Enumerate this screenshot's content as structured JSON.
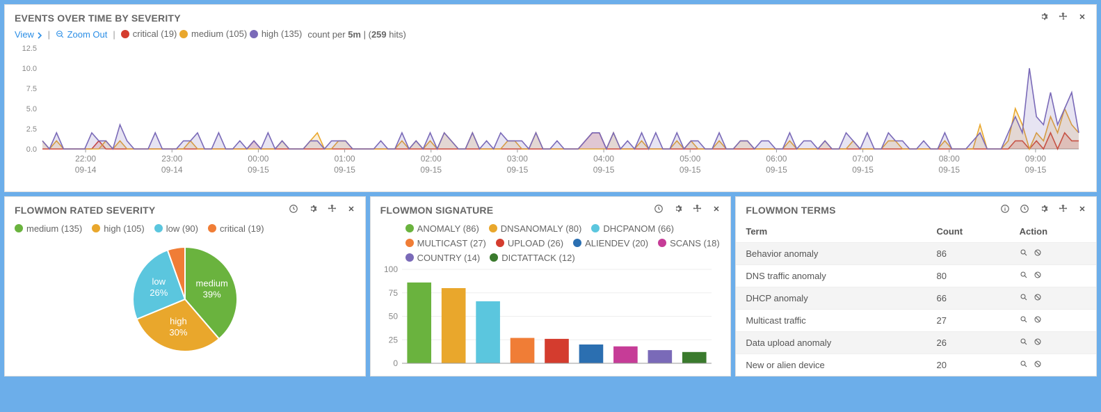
{
  "events_panel": {
    "title": "EVENTS OVER TIME BY SEVERITY",
    "view_label": "View",
    "zoom_label": "Zoom Out",
    "count_prefix": "count per",
    "count_interval": "5m",
    "hits": "259",
    "hits_suffix": "hits",
    "legend": [
      {
        "label": "critical (19)",
        "color": "#d43c2e"
      },
      {
        "label": "medium (105)",
        "color": "#e9a72c"
      },
      {
        "label": "high (135)",
        "color": "#7a6ab8"
      }
    ]
  },
  "chart_data": [
    {
      "panel": "events_over_time",
      "type": "area",
      "ylim": [
        0,
        12.5
      ],
      "y_ticks": [
        0.0,
        2.5,
        5.0,
        7.5,
        10.0,
        12.5
      ],
      "x_major": [
        {
          "top": "22:00",
          "bottom": "09-14"
        },
        {
          "top": "23:00",
          "bottom": "09-14"
        },
        {
          "top": "00:00",
          "bottom": "09-15"
        },
        {
          "top": "01:00",
          "bottom": "09-15"
        },
        {
          "top": "02:00",
          "bottom": "09-15"
        },
        {
          "top": "03:00",
          "bottom": "09-15"
        },
        {
          "top": "04:00",
          "bottom": "09-15"
        },
        {
          "top": "05:00",
          "bottom": "09-15"
        },
        {
          "top": "06:00",
          "bottom": "09-15"
        },
        {
          "top": "07:00",
          "bottom": "09-15"
        },
        {
          "top": "08:00",
          "bottom": "09-15"
        },
        {
          "top": "09:00",
          "bottom": "09-15"
        }
      ],
      "series": [
        {
          "name": "critical",
          "color": "#d43c2e",
          "values": [
            0,
            0,
            0,
            0,
            0,
            0,
            0,
            0,
            1,
            0,
            0,
            0,
            0,
            0,
            0,
            0,
            0,
            0,
            0,
            0,
            0,
            0,
            0,
            0,
            0,
            0,
            0,
            0,
            0,
            0,
            1,
            0,
            0,
            0,
            0,
            0,
            0,
            0,
            0,
            0,
            0,
            0,
            0,
            0,
            0,
            0,
            0,
            0,
            0,
            0,
            0,
            0,
            0,
            0,
            0,
            0,
            0,
            0,
            0,
            0,
            0,
            0,
            0,
            0,
            0,
            0,
            0,
            0,
            0,
            0,
            0,
            0,
            0,
            0,
            0,
            0,
            0,
            1,
            2,
            2,
            0,
            0,
            0,
            0,
            0,
            0,
            0,
            0,
            0,
            0,
            0,
            0,
            0,
            0,
            0,
            0,
            0,
            0,
            0,
            0,
            0,
            0,
            0,
            0,
            0,
            0,
            0,
            0,
            0,
            0,
            0,
            0,
            0,
            0,
            0,
            0,
            0,
            0,
            0,
            0,
            0,
            0,
            0,
            0,
            0,
            0,
            0,
            0,
            0,
            0,
            0,
            0,
            0,
            0,
            0,
            0,
            0,
            0,
            1,
            1,
            0,
            1,
            0,
            2,
            0,
            2,
            1,
            1
          ]
        },
        {
          "name": "medium",
          "color": "#e9a72c",
          "values": [
            1,
            0,
            1,
            0,
            0,
            0,
            0,
            0,
            0,
            1,
            0,
            1,
            0,
            0,
            0,
            0,
            0,
            0,
            0,
            0,
            0,
            1,
            0,
            0,
            0,
            0,
            0,
            0,
            0,
            0,
            0,
            0,
            0,
            0,
            1,
            0,
            0,
            0,
            1,
            2,
            0,
            0,
            1,
            1,
            0,
            0,
            0,
            0,
            0,
            0,
            0,
            1,
            0,
            1,
            0,
            1,
            0,
            2,
            1,
            0,
            0,
            2,
            0,
            0,
            0,
            0,
            1,
            1,
            0,
            0,
            2,
            0,
            0,
            0,
            0,
            0,
            0,
            0,
            0,
            0,
            0,
            2,
            0,
            0,
            0,
            1,
            0,
            0,
            0,
            0,
            1,
            0,
            1,
            0,
            0,
            0,
            1,
            0,
            0,
            1,
            1,
            0,
            0,
            0,
            0,
            0,
            1,
            0,
            0,
            0,
            0,
            1,
            0,
            0,
            0,
            1,
            0,
            0,
            0,
            0,
            1,
            1,
            0,
            0,
            0,
            0,
            0,
            0,
            1,
            0,
            0,
            0,
            0,
            3,
            0,
            0,
            0,
            1,
            5,
            3,
            0,
            2,
            1,
            4,
            2,
            5,
            3,
            2
          ]
        },
        {
          "name": "high",
          "color": "#7a6ab8",
          "values": [
            1,
            0,
            2,
            0,
            0,
            0,
            0,
            2,
            1,
            1,
            0,
            3,
            1,
            0,
            0,
            0,
            2,
            0,
            0,
            0,
            1,
            1,
            2,
            0,
            0,
            2,
            0,
            0,
            1,
            0,
            1,
            0,
            2,
            0,
            1,
            0,
            0,
            0,
            1,
            1,
            0,
            1,
            1,
            1,
            0,
            0,
            0,
            0,
            1,
            0,
            0,
            2,
            0,
            1,
            0,
            2,
            0,
            2,
            1,
            0,
            0,
            2,
            0,
            1,
            0,
            2,
            1,
            1,
            1,
            0,
            2,
            0,
            0,
            1,
            0,
            0,
            0,
            1,
            2,
            2,
            0,
            2,
            0,
            1,
            0,
            2,
            0,
            2,
            0,
            0,
            2,
            0,
            1,
            1,
            0,
            0,
            2,
            0,
            0,
            1,
            1,
            0,
            1,
            1,
            0,
            0,
            2,
            0,
            1,
            1,
            0,
            1,
            0,
            0,
            2,
            1,
            0,
            2,
            0,
            0,
            2,
            1,
            1,
            0,
            0,
            1,
            0,
            0,
            2,
            0,
            0,
            0,
            1,
            2,
            0,
            0,
            0,
            2,
            4,
            2,
            10,
            4,
            3,
            7,
            3,
            5,
            7,
            2
          ]
        }
      ]
    },
    {
      "panel": "flowmon_rated_severity",
      "type": "pie",
      "title": "FLOWMON RATED SEVERITY",
      "series": [
        {
          "name": "medium",
          "value": 135,
          "pct": 39,
          "color": "#6ab33e",
          "label": "medium (135)"
        },
        {
          "name": "high",
          "value": 105,
          "pct": 30,
          "color": "#e9a72c",
          "label": "high (105)"
        },
        {
          "name": "low",
          "value": 90,
          "pct": 26,
          "color": "#5bc6de",
          "label": "low (90)"
        },
        {
          "name": "critical",
          "value": 19,
          "pct": 5,
          "color": "#f07d36",
          "label": "critical (19)"
        }
      ]
    },
    {
      "panel": "flowmon_signature",
      "type": "bar",
      "title": "FLOWMON SIGNATURE",
      "ylim": [
        0,
        100
      ],
      "y_ticks": [
        0,
        25,
        50,
        75,
        100
      ],
      "series": [
        {
          "name": "ANOMALY",
          "value": 86,
          "color": "#6ab33e",
          "label": "ANOMALY (86)"
        },
        {
          "name": "DNSANOMALY",
          "value": 80,
          "color": "#e9a72c",
          "label": "DNSANOMALY (80)"
        },
        {
          "name": "DHCPANOM",
          "value": 66,
          "color": "#5bc6de",
          "label": "DHCPANOM (66)"
        },
        {
          "name": "MULTICAST",
          "value": 27,
          "color": "#f07d36",
          "label": "MULTICAST (27)"
        },
        {
          "name": "UPLOAD",
          "value": 26,
          "color": "#d43c2e",
          "label": "UPLOAD (26)"
        },
        {
          "name": "ALIENDEV",
          "value": 20,
          "color": "#2b6fb1",
          "label": "ALIENDEV (20)"
        },
        {
          "name": "SCANS",
          "value": 18,
          "color": "#c63c97",
          "label": "SCANS (18)"
        },
        {
          "name": "COUNTRY",
          "value": 14,
          "color": "#7a6ab8",
          "label": "COUNTRY (14)"
        },
        {
          "name": "DICTATTACK",
          "value": 12,
          "color": "#3a7a2d",
          "label": "DICTATTACK (12)"
        }
      ]
    }
  ],
  "terms_panel": {
    "title": "FLOWMON TERMS",
    "headers": {
      "term": "Term",
      "count": "Count",
      "action": "Action"
    },
    "rows": [
      {
        "term": "Behavior anomaly",
        "count": 86
      },
      {
        "term": "DNS traffic anomaly",
        "count": 80
      },
      {
        "term": "DHCP anomaly",
        "count": 66
      },
      {
        "term": "Multicast traffic",
        "count": 27
      },
      {
        "term": "Data upload anomaly",
        "count": 26
      },
      {
        "term": "New or alien device",
        "count": 20
      }
    ]
  },
  "severity_panel": {
    "title": "FLOWMON RATED SEVERITY"
  },
  "signature_panel": {
    "title": "FLOWMON SIGNATURE"
  }
}
